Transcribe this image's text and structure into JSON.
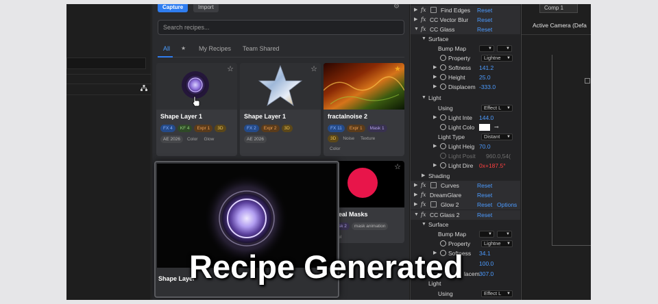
{
  "recipes": {
    "capture_label": "Capture",
    "import_label": "Import",
    "search_placeholder": "Search recipes...",
    "tabs": [
      "All",
      "★",
      "My Recipes",
      "Team Shared"
    ],
    "cards": [
      {
        "title": "Shape Layer 1",
        "tags": [
          "FX 4",
          "KF 4",
          "Expr 1",
          "3D"
        ],
        "meta": [
          "AE 2026",
          "Color",
          "Glow"
        ],
        "starred": false
      },
      {
        "title": "Shape Layer 1",
        "tags": [
          "FX 2",
          "Expr 2",
          "3D"
        ],
        "meta": [
          "AE 2026"
        ],
        "starred": false
      },
      {
        "title": "fractalnoise 2",
        "tags": [
          "FX 11",
          "Expr 1",
          "Mask 1",
          "3D",
          "Noise",
          "Texture",
          "Color"
        ],
        "meta": [],
        "starred": true
      },
      {
        "title": "eal Masks",
        "tags": [
          "sk 2",
          "mask animation",
          "ol"
        ],
        "meta": [],
        "starred": false
      }
    ],
    "overlay_title": "Shape Layer"
  },
  "effects": {
    "reset": "Reset",
    "options": "Options",
    "rows": {
      "find_edges": "Find Edges",
      "cc_vector_blur": "CC Vector Blur",
      "cc_glass": "CC Glass",
      "surface": "Surface",
      "bump_map": "Bump Map",
      "property": "Property",
      "property_val": "Lightne",
      "softness": "Softness",
      "softness_val": "141.2",
      "height": "Height",
      "height_val": "25.0",
      "displacement": "Displacem",
      "displacement_val": "-333.0",
      "light": "Light",
      "using": "Using",
      "using_val": "Effect L",
      "light_intensity": "Light Inte",
      "light_intensity_val": "144.0",
      "light_color": "Light Colo",
      "light_type": "Light Type",
      "light_type_val": "Distant",
      "light_height": "Light Heig",
      "light_height_val": "70.0",
      "light_position": "Light Posit",
      "light_position_val": "960.0,54(",
      "light_direction": "Light Dire",
      "light_direction_val": "0x+187.5°",
      "shading": "Shading",
      "curves": "Curves",
      "dreamglare": "DreamGlare",
      "glow_2": "Glow 2",
      "cc_glass_2": "CC Glass 2",
      "surface_2": "Surface",
      "bump_map_2": "Bump Map",
      "property_2": "Property",
      "property_2_val": "Lightne",
      "softness_2": "Softness",
      "softness_2_val": "34.1",
      "height_2_val": "100.0",
      "displacement_2": "lacem",
      "displacement_2_val": "307.0",
      "light_2": "Light",
      "using_2": "Using",
      "using_2_val": "Effect L"
    }
  },
  "viewer": {
    "comp_tab": "Comp 1",
    "camera_label": "Active Camera (Defa"
  },
  "caption": "Recipe Generated",
  "colors": {
    "accent": "#2f7df0",
    "value_blue": "#4c9bff",
    "star": "#f2a81d"
  }
}
